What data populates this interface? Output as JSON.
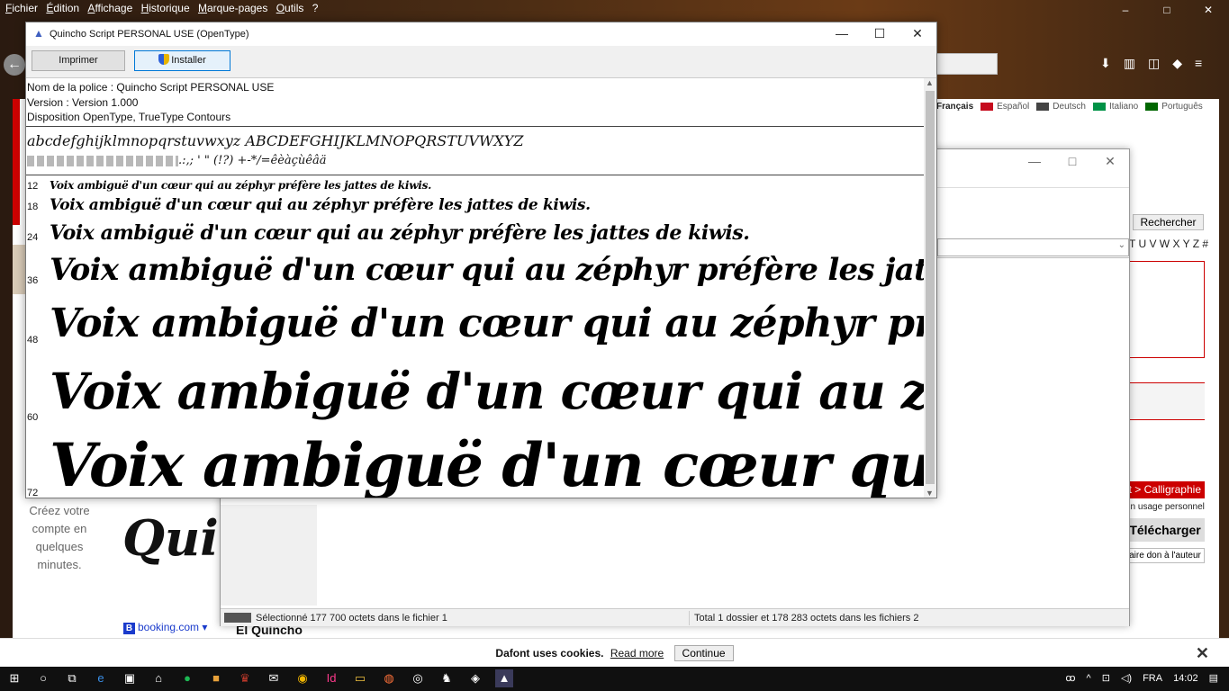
{
  "browser": {
    "menu": [
      "Fichier",
      "Édition",
      "Affichage",
      "Historique",
      "Marque-pages",
      "Outils",
      "?"
    ],
    "window_controls": [
      "–",
      "□",
      "✕"
    ]
  },
  "page": {
    "languages": [
      "Français",
      "Español",
      "Deutsch",
      "Italiano",
      "Português"
    ],
    "language_flag_colors": [
      "#1d3b9a",
      "#c60b1e",
      "#222",
      "#009246",
      "#006600"
    ],
    "search_button": "Rechercher",
    "alphabet_tail": "T U V W X Y Z #",
    "signup_text": "Créez votre compte en quelques minutes.",
    "font_preview_title": "Quin",
    "booking_label": "booking.com ▾",
    "font_name_footer": "El Quincho",
    "category_tag": "t > Calligraphie",
    "usage": "un usage personnel",
    "download": "Télécharger",
    "donate": "aire don à l'auteur"
  },
  "archive_window": {
    "controls": [
      "—",
      "□",
      "✕"
    ],
    "status_left": "Sélectionné 177 700 octets dans le fichier 1",
    "status_right": "Total 1 dossier et 178 283 octets dans les fichiers 2"
  },
  "font_viewer": {
    "title": "Quincho Script PERSONAL USE (OpenType)",
    "controls": [
      "—",
      "☐",
      "✕"
    ],
    "print_button": "Imprimer",
    "install_button": "Installer",
    "font_name_line": "Nom de la police : Quincho Script PERSONAL USE",
    "version_line": "Version : Version 1.000",
    "layout_line": "Disposition OpenType, TrueType  Contours",
    "alphabet_line": "abcdefghijklmnopqrstuvwxyz ABCDEFGHIJKLMNOPQRSTUVWXYZ",
    "symbols_line": ".:,; ' \" (!?) +-*/=êèàçùêâä",
    "sample_text": "Voix ambiguë d'un cœur qui au zéphyr préfère les jattes de kiwis.",
    "sizes": [
      "12",
      "18",
      "24",
      "36",
      "48",
      "60",
      "72"
    ]
  },
  "cookie_bar": {
    "message": "Dafont uses cookies.",
    "read_more": "Read more",
    "continue": "Continue",
    "close": "✕"
  },
  "taskbar": {
    "lang": "FRA",
    "time": "14:02"
  }
}
